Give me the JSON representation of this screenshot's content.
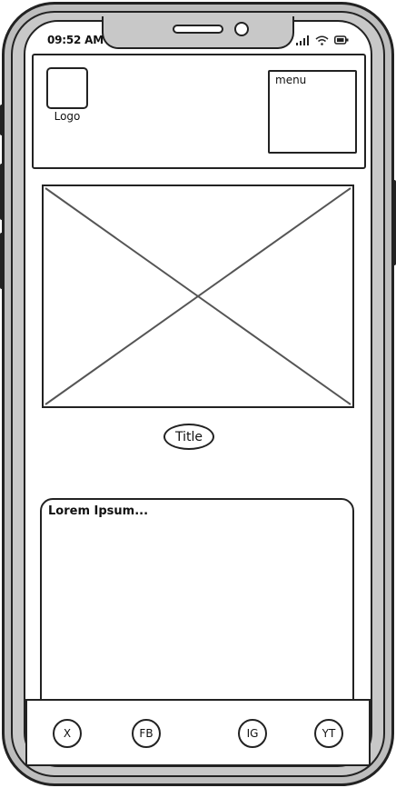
{
  "status_bar": {
    "time": "09:52 AM",
    "icons": [
      "signal-icon",
      "wifi-icon",
      "battery-icon"
    ]
  },
  "header": {
    "logo_label": "Logo",
    "menu_label": "menu"
  },
  "hero": {
    "image_icon": "image-placeholder-icon",
    "title": "Title"
  },
  "content": {
    "text": "Lorem Ipsum..."
  },
  "footer": {
    "social_links": [
      {
        "label": "X"
      },
      {
        "label": "FB"
      },
      {
        "label": "IG"
      },
      {
        "label": "YT"
      }
    ]
  }
}
